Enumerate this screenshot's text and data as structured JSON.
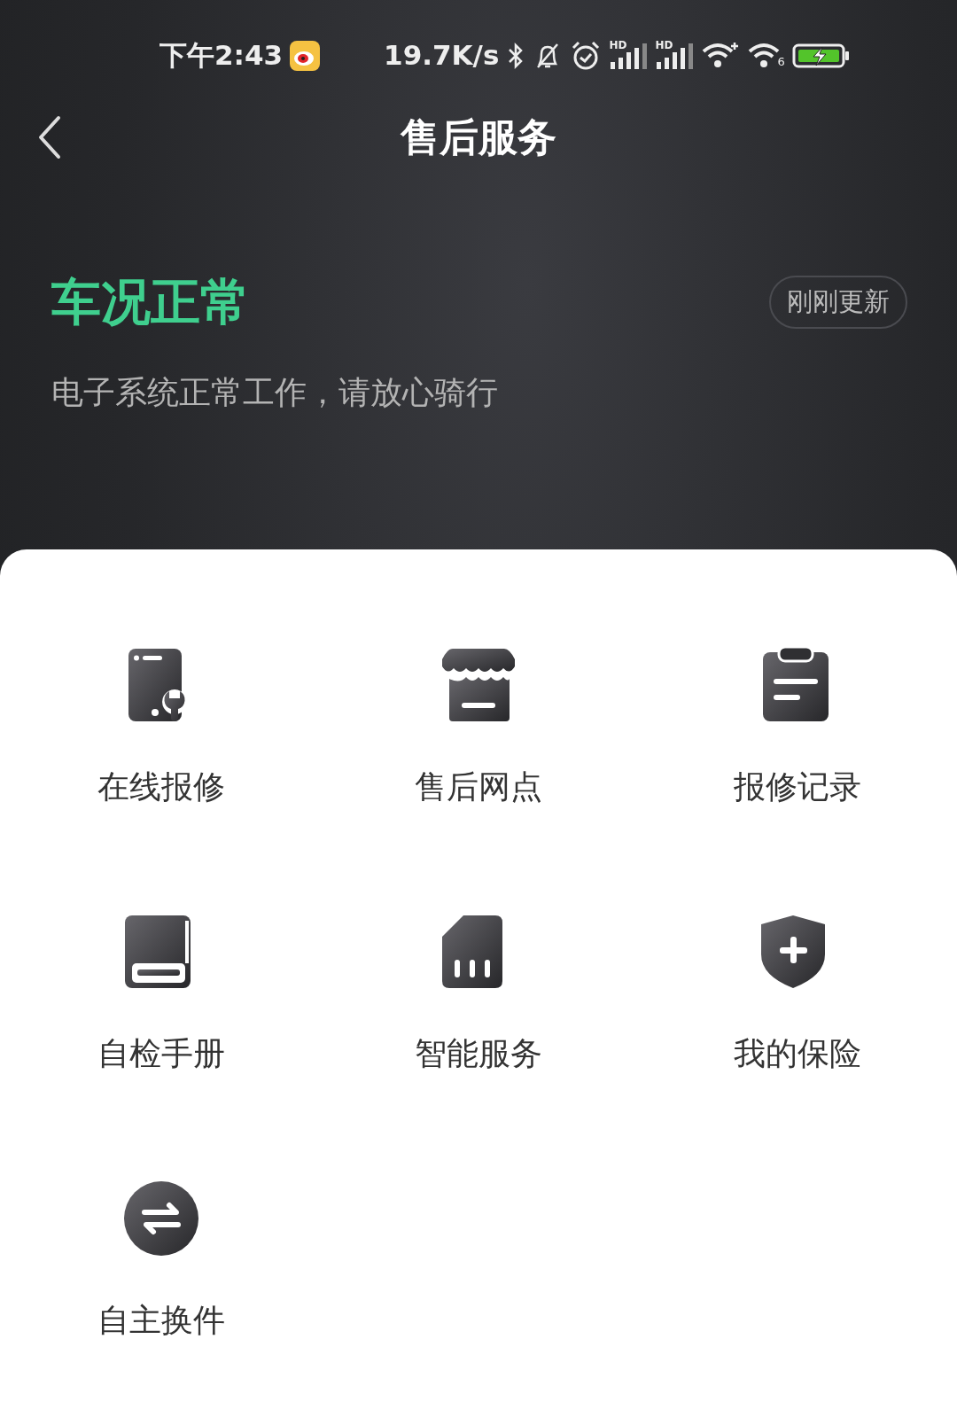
{
  "status_bar": {
    "time": "下午2:43",
    "net_speed": "19.7K/s",
    "hd_labels": [
      "HD",
      "HD"
    ],
    "wifi_badge": "6"
  },
  "header": {
    "title": "售后服务"
  },
  "condition": {
    "title": "车况正常",
    "badge": "刚刚更新",
    "message": "电子系统正常工作，请放心骑行"
  },
  "services": [
    {
      "kind": "phone-repair",
      "label": "在线报修"
    },
    {
      "kind": "store",
      "label": "售后网点"
    },
    {
      "kind": "clipboard",
      "label": "报修记录"
    },
    {
      "kind": "book",
      "label": "自检手册"
    },
    {
      "kind": "sim",
      "label": "智能服务"
    },
    {
      "kind": "shield",
      "label": "我的保险"
    },
    {
      "kind": "swap",
      "label": "自主换件"
    }
  ]
}
